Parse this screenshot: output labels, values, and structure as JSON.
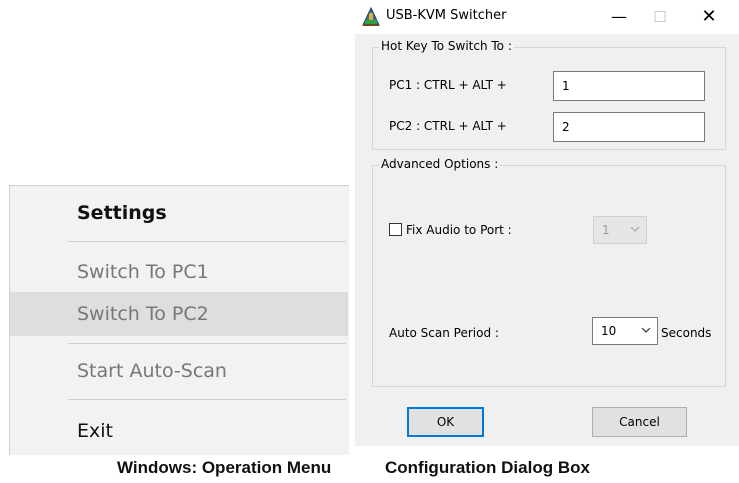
{
  "menu": {
    "items": [
      {
        "label": "Settings"
      },
      {
        "label": "Switch To PC1"
      },
      {
        "label": "Switch To PC2"
      },
      {
        "label": "Start Auto-Scan"
      },
      {
        "label": "Exit"
      }
    ]
  },
  "dialog": {
    "title": "USB-KVM Switcher",
    "titlebar_buttons": {
      "minimize": "—",
      "maximize": "☐",
      "close": "✕"
    },
    "hotkey_group": {
      "label": "Hot Key To Switch To :",
      "pc1_label": "PC1 : CTRL + ALT +",
      "pc1_value": "1",
      "pc2_label": "PC2 : CTRL + ALT +",
      "pc2_value": "2"
    },
    "advanced_group": {
      "label": "Advanced Options :",
      "fix_audio_label": "Fix Audio to Port :",
      "fix_audio_checked": false,
      "audio_port_value": "1",
      "auto_scan_label": "Auto Scan Period :",
      "auto_scan_value": "10",
      "auto_scan_unit": "Seconds"
    },
    "ok_label": "OK",
    "cancel_label": "Cancel"
  },
  "captions": {
    "left": "Windows: Operation Menu",
    "right": "Configuration Dialog Box"
  },
  "colors": {
    "accent": "#0078d7",
    "menu_bg": "#f2f2f2",
    "dialog_bg": "#f0f0f0"
  }
}
